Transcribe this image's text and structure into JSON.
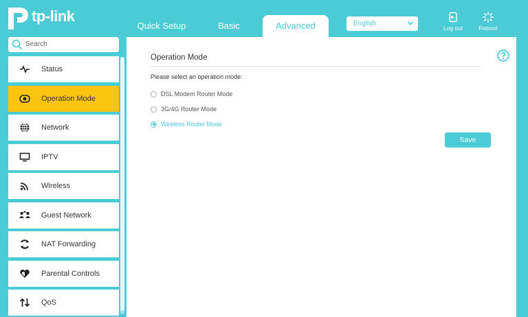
{
  "brand": {
    "name": "tp-link"
  },
  "tabs": [
    {
      "label": "Quick Setup"
    },
    {
      "label": "Basic"
    },
    {
      "label": "Advanced",
      "active": true
    }
  ],
  "header": {
    "language": "English",
    "logout_label": "Log out",
    "reboot_label": "Reboot"
  },
  "search": {
    "placeholder": "Search"
  },
  "sidebar": {
    "items": [
      {
        "label": "Status",
        "icon": "status-pulse-icon"
      },
      {
        "label": "Operation Mode",
        "icon": "toggle-icon",
        "active": true
      },
      {
        "label": "Network",
        "icon": "globe-icon"
      },
      {
        "label": "IPTV",
        "icon": "monitor-icon"
      },
      {
        "label": "Wireless",
        "icon": "wifi-icon"
      },
      {
        "label": "Guest Network",
        "icon": "guest-icon"
      },
      {
        "label": "NAT Forwarding",
        "icon": "nat-icon"
      },
      {
        "label": "Parental Controls",
        "icon": "heart-icon"
      },
      {
        "label": "QoS",
        "icon": "qos-icon"
      }
    ]
  },
  "main": {
    "title": "Operation Mode",
    "prompt": "Please select an operation mode:",
    "options": [
      {
        "label": "DSL Modem Router Mode",
        "selected": false
      },
      {
        "label": "3G/4G Router Mode",
        "selected": false
      },
      {
        "label": "Wireless Router Mode",
        "selected": true
      }
    ],
    "save_label": "Save"
  },
  "colors": {
    "accent": "#4acbd6",
    "active_item": "#fcc40e"
  }
}
